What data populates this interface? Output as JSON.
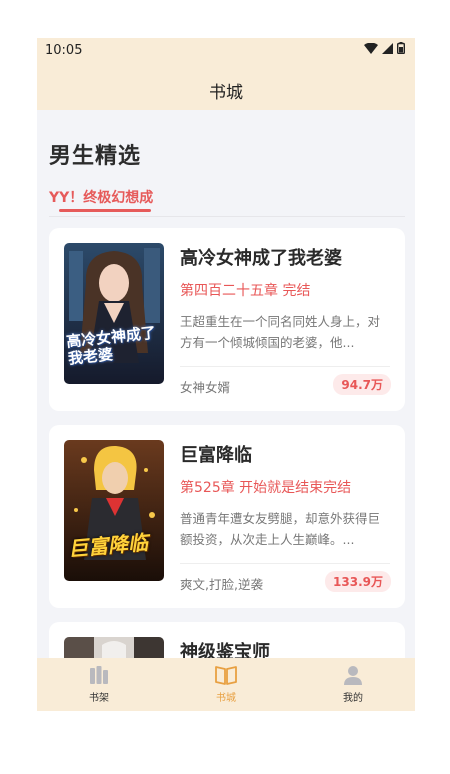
{
  "status": {
    "time": "10:05"
  },
  "header": {
    "title": "书城"
  },
  "section": {
    "title": "男生精选"
  },
  "tabs": [
    {
      "label": "YY！终极幻想成"
    }
  ],
  "books": [
    {
      "title": "高冷女神成了我老婆",
      "chapter": "第四百二十五章 完结",
      "desc": "王超重生在一个同名同姓人身上，对方有一个倾城倾国的老婆，他...",
      "tags": "女神女婿",
      "count": "94.7万",
      "cover_text": "高冷女神成了我老婆"
    },
    {
      "title": "巨富降临",
      "chapter": "第525章 开始就是结束完结",
      "desc": "普通青年遭女友劈腿，却意外获得巨额投资，从次走上人生巅峰。...",
      "tags": "爽文,打脸,逆袭",
      "count": "133.9万",
      "cover_text": "巨富降临"
    },
    {
      "title": "神级鉴宝师"
    }
  ],
  "nav": [
    {
      "label": "书架",
      "icon": "bookshelf-icon"
    },
    {
      "label": "书城",
      "icon": "open-book-icon"
    },
    {
      "label": "我的",
      "icon": "person-icon"
    }
  ],
  "colors": {
    "accent": "#e85757",
    "nav_active": "#e8a042",
    "bar_bg": "#f9ecd7"
  }
}
